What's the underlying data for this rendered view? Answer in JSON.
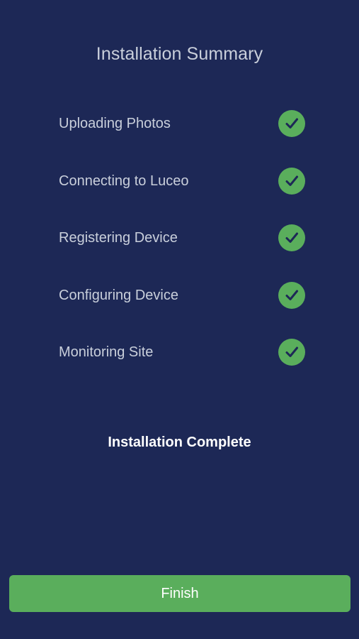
{
  "page": {
    "title": "Installation Summary",
    "status_text": "Installation Complete"
  },
  "steps": [
    {
      "label": "Uploading Photos",
      "status": "complete",
      "icon": "check-icon"
    },
    {
      "label": "Connecting to Luceo",
      "status": "complete",
      "icon": "check-icon"
    },
    {
      "label": "Registering Device",
      "status": "complete",
      "icon": "check-icon"
    },
    {
      "label": "Configuring Device",
      "status": "complete",
      "icon": "check-icon"
    },
    {
      "label": "Monitoring Site",
      "status": "complete",
      "icon": "check-icon"
    }
  ],
  "actions": {
    "finish_label": "Finish"
  },
  "colors": {
    "background": "#1d2856",
    "accent_green": "#5aae5c",
    "text_muted": "#c9cfdb",
    "text_white": "#ffffff"
  }
}
